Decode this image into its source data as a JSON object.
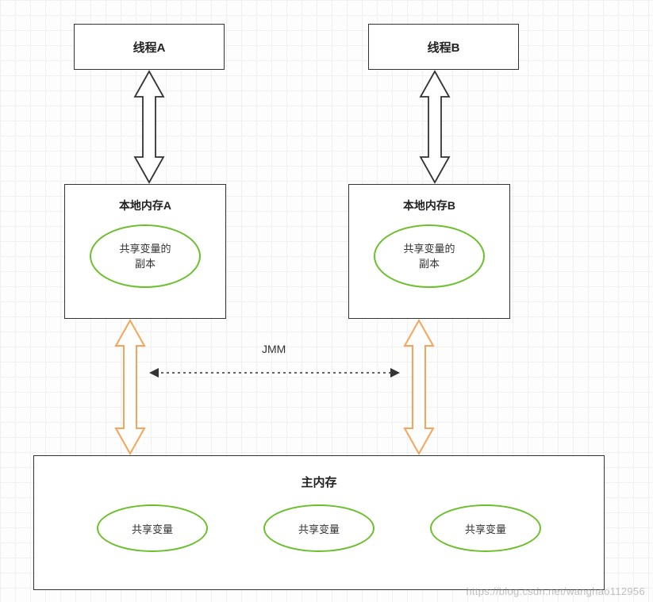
{
  "threadA": {
    "title": "线程A"
  },
  "threadB": {
    "title": "线程B"
  },
  "localMemA": {
    "title": "本地内存A",
    "ellipse_line1": "共享变量的",
    "ellipse_line2": "副本"
  },
  "localMemB": {
    "title": "本地内存B",
    "ellipse_line1": "共享变量的",
    "ellipse_line2": "副本"
  },
  "jmm_label": "JMM",
  "mainMem": {
    "title": "主内存",
    "shared1": "共享变量",
    "shared2": "共享变量",
    "shared3": "共享变量"
  },
  "watermark": "https://blog.csdn.net/wanghao112956"
}
